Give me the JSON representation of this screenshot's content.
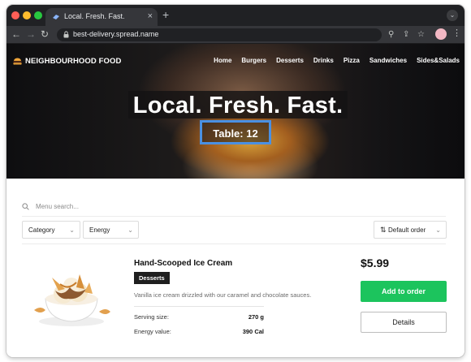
{
  "browser": {
    "tab_title": "Local. Fresh. Fast.",
    "tab_close": "×",
    "new_tab": "+",
    "url": "best-delivery.spread.name"
  },
  "site": {
    "brand": "NEIGHBOURHOOD FOOD",
    "nav": [
      "Home",
      "Burgers",
      "Desserts",
      "Drinks",
      "Pizza",
      "Sandwiches",
      "Sides&Salads"
    ],
    "headline": "Local. Fresh. Fast.",
    "table_label": "Table: 12"
  },
  "filters": {
    "search_placeholder": "Menu search...",
    "category": "Category",
    "energy": "Energy",
    "order": "Default order"
  },
  "product": {
    "name": "Hand-Scooped Ice Cream",
    "badge": "Desserts",
    "description": "Vanilla ice cream drizzled with our caramel and chocolate sauces.",
    "specs": [
      {
        "label": "Serving size:",
        "value": "270 g"
      },
      {
        "label": "Energy value:",
        "value": "390 Cal"
      }
    ],
    "price": "$5.99",
    "add_label": "Add to order",
    "details_label": "Details"
  },
  "colors": {
    "accent_green": "#1cc45d",
    "focus_blue": "#4a90e2"
  }
}
